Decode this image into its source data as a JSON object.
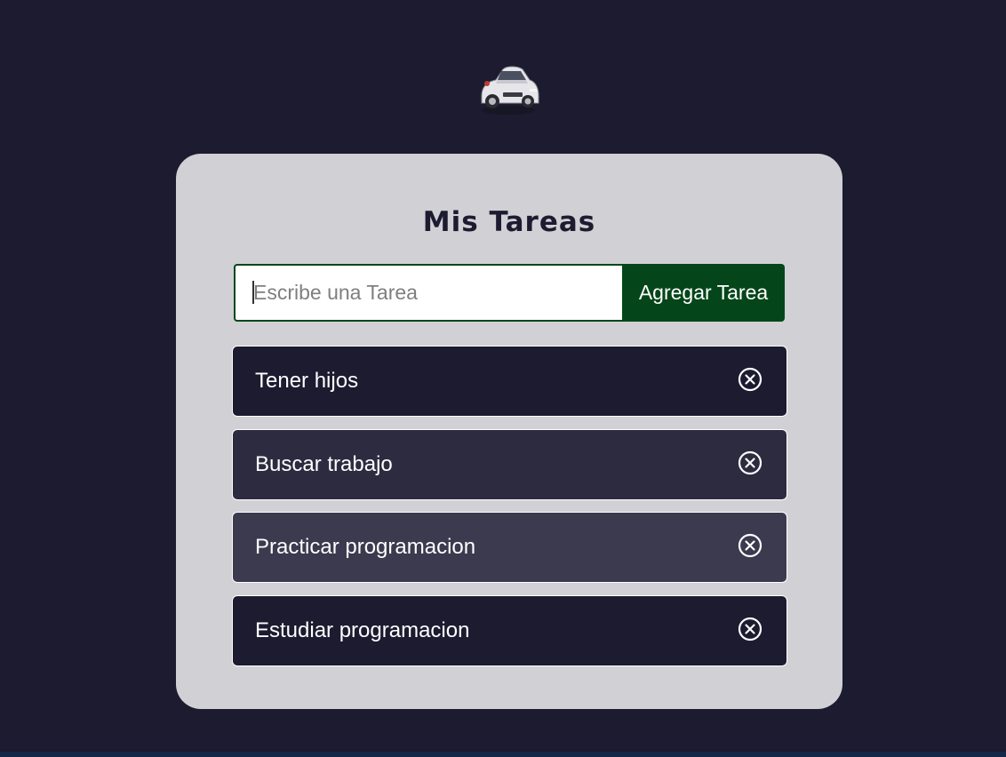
{
  "app": {
    "title": "Mis Tareas"
  },
  "form": {
    "placeholder": "Escribe una Tarea",
    "value": "",
    "add_label": "Agregar Tarea",
    "accent_color": "#044619"
  },
  "tasks": [
    {
      "text": "Tener hijos",
      "bg": "#1c1b30"
    },
    {
      "text": "Buscar trabajo",
      "bg": "#2c2b40"
    },
    {
      "text": "Practicar programacion",
      "bg": "#3b3a4f"
    },
    {
      "text": "Estudiar programacion",
      "bg": "#1c1b30"
    }
  ],
  "icons": {
    "logo": "car-icon",
    "delete": "circle-x-icon"
  },
  "colors": {
    "page_bg": "#1c1b30",
    "card_bg": "#d1d0d5"
  }
}
